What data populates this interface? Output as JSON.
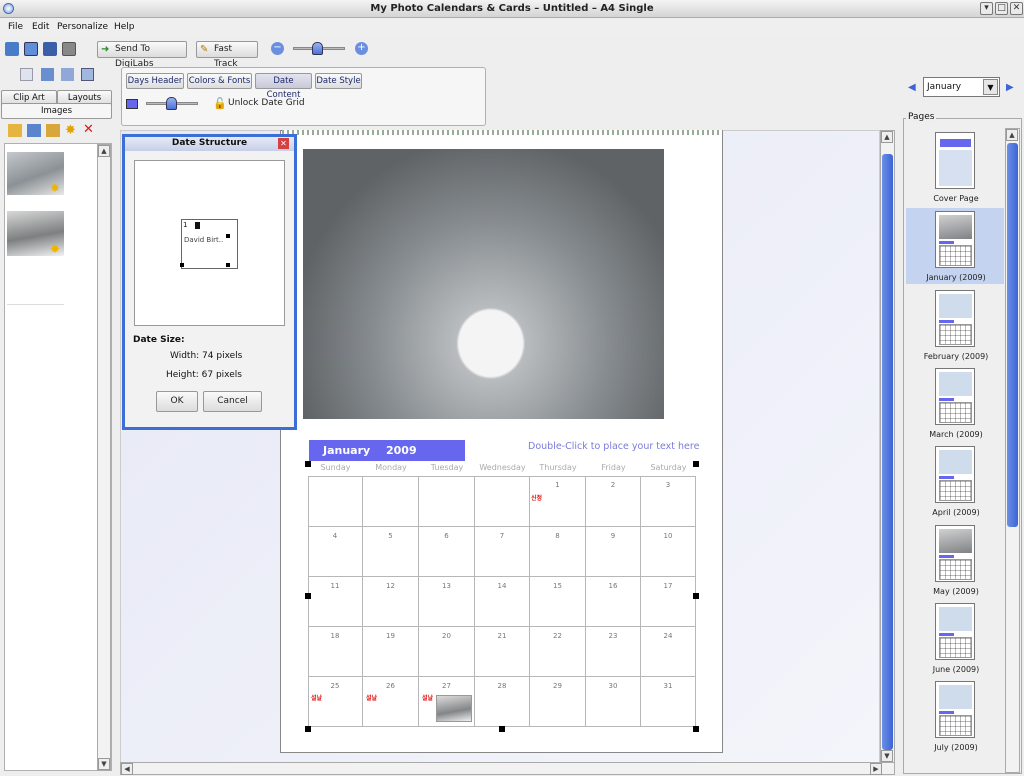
{
  "window": {
    "title": "My Photo Calendars & Cards – Untitled – A4 Single",
    "btn_min": "▾",
    "btn_max": "□",
    "btn_close": "✕"
  },
  "menu": {
    "file": "File",
    "edit": "Edit",
    "personalize": "Personalize",
    "help": "Help"
  },
  "toolbar": {
    "send_label": "Send To  DigiLabs",
    "fasttrack_label": "Fast Track",
    "zoom_out": "−",
    "zoom_in": "+"
  },
  "left_panel": {
    "tab_clipart": "Clip Art",
    "tab_layouts": "Layouts",
    "tab_images": "Images"
  },
  "options": {
    "tabs": [
      "Days Header",
      "Colors & Fonts",
      "Date Content",
      "Date Style"
    ],
    "unlock_label": "Unlock Date Grid"
  },
  "month_nav": {
    "selected": "January",
    "prev": "◀",
    "next": "▶"
  },
  "pages_panel": {
    "title": "Pages",
    "items": [
      "Cover Page",
      "January (2009)",
      "February (2009)",
      "March (2009)",
      "April (2009)",
      "May (2009)",
      "June (2009)",
      "July (2009)"
    ]
  },
  "dialog": {
    "title": "Date Structure",
    "preview_text": "David Birt..",
    "preview_num": "1",
    "size_heading": "Date Size:",
    "width_label": "Width:  74 pixels",
    "height_label": "Height:  67 pixels",
    "ok": "OK",
    "cancel": "Cancel"
  },
  "calendar": {
    "month_label": "January",
    "year_label": "2009",
    "hint": "Double-Click to place your text here",
    "day_names": [
      "Sunday",
      "Monday",
      "Tuesday",
      "Wednesday",
      "Thursday",
      "Friday",
      "Saturday"
    ],
    "weeks": [
      [
        "",
        "",
        "",
        "",
        "1",
        "2",
        "3"
      ],
      [
        "4",
        "5",
        "6",
        "7",
        "8",
        "9",
        "10"
      ],
      [
        "11",
        "12",
        "13",
        "14",
        "15",
        "16",
        "17"
      ],
      [
        "18",
        "19",
        "20",
        "21",
        "22",
        "23",
        "24"
      ],
      [
        "25",
        "26",
        "27",
        "28",
        "29",
        "30",
        "31"
      ]
    ],
    "notes": {
      "d1": "신정",
      "d25": "설날",
      "d26": "설날",
      "d27": "설날"
    }
  },
  "colors": {
    "accent": "#6666ee",
    "scroll": "#4a72dc",
    "dialog_border": "#3b6fd6",
    "note_red": "#e01010"
  }
}
